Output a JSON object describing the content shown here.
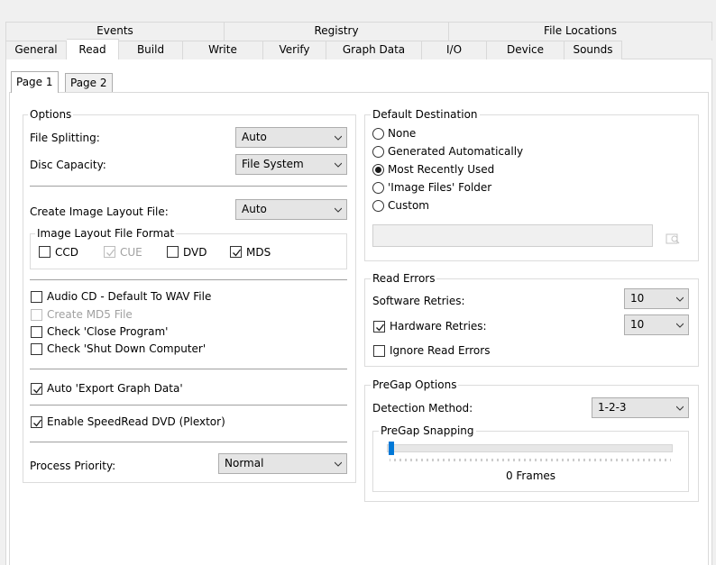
{
  "tabs_row1": [
    {
      "label": "Events",
      "w": 243
    },
    {
      "label": "Registry",
      "w": 249
    },
    {
      "label": "File Locations",
      "w": 292
    }
  ],
  "tabs_row2": [
    {
      "label": "General"
    },
    {
      "label": "Read"
    },
    {
      "label": "Build"
    },
    {
      "label": "Write"
    },
    {
      "label": "Verify"
    },
    {
      "label": "Graph Data"
    },
    {
      "label": "I/O"
    },
    {
      "label": "Device"
    },
    {
      "label": "Sounds"
    }
  ],
  "subtabs": {
    "page1": "Page 1",
    "page2": "Page 2"
  },
  "options": {
    "title": "Options",
    "file_splitting_label": "File Splitting:",
    "file_splitting_value": "Auto",
    "disc_capacity_label": "Disc Capacity:",
    "disc_capacity_value": "File System",
    "create_layout_label": "Create Image Layout File:",
    "create_layout_value": "Auto",
    "layout_format_title": "Image Layout File Format",
    "fmt_ccd": "CCD",
    "fmt_cue": "CUE",
    "fmt_dvd": "DVD",
    "fmt_mds": "MDS",
    "audio_cd": "Audio CD - Default To WAV File",
    "create_md5": "Create MD5 File",
    "check_close": "Check 'Close Program'",
    "check_shutdown": "Check 'Shut Down Computer'",
    "auto_export": "Auto 'Export Graph Data'",
    "speedread": "Enable SpeedRead DVD (Plextor)",
    "priority_label": "Process Priority:",
    "priority_value": "Normal"
  },
  "destination": {
    "title": "Default Destination",
    "none": "None",
    "generated": "Generated Automatically",
    "recent": "Most Recently Used",
    "image_folder": "'Image Files' Folder",
    "custom": "Custom",
    "selected": "recent"
  },
  "read_errors": {
    "title": "Read Errors",
    "software_label": "Software Retries:",
    "software_value": "10",
    "hardware_label": "Hardware Retries:",
    "hardware_value": "10",
    "ignore_label": "Ignore Read Errors"
  },
  "pregap": {
    "title": "PreGap Options",
    "detection_label": "Detection Method:",
    "detection_value": "1-2-3",
    "snapping_title": "PreGap Snapping",
    "snapping_value": "0 Frames"
  },
  "colors": {
    "accent": "#0078d7",
    "check": "#1a1a1a",
    "disabled": "#a0a0a0"
  }
}
